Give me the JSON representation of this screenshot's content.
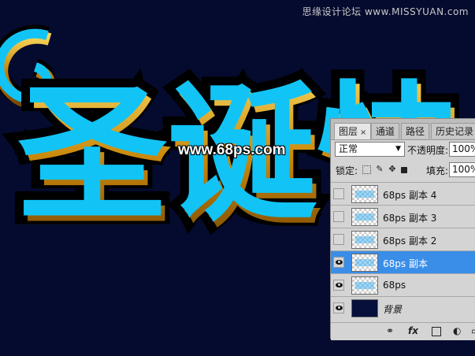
{
  "watermark": "思缘设计论坛 www.MISSYUAN.com",
  "artwork": {
    "headline": "圣诞快",
    "site": "www.68ps.com"
  },
  "layers_panel": {
    "tabs": [
      {
        "label": "图层",
        "close": "×"
      },
      {
        "label": "通道"
      },
      {
        "label": "路径"
      },
      {
        "label": "历史记录"
      }
    ],
    "blend_mode": "正常",
    "opacity_label": "不透明度:",
    "opacity_value": "100%",
    "lock_label": "锁定:",
    "fill_label": "填充:",
    "fill_value": "100%",
    "layers": [
      {
        "name": "68ps 副本 4",
        "visible": false,
        "selected": false
      },
      {
        "name": "68ps 副本 3",
        "visible": false,
        "selected": false
      },
      {
        "name": "68ps 副本 2",
        "visible": false,
        "selected": false
      },
      {
        "name": "68ps 副本",
        "visible": true,
        "selected": true
      },
      {
        "name": "68ps",
        "visible": true,
        "selected": false
      },
      {
        "name": "背景",
        "visible": true,
        "selected": false
      }
    ],
    "bottom_icons": [
      "link-icon",
      "fx-icon",
      "mask-icon",
      "adjustment-icon",
      "folder-icon"
    ],
    "fx_text": "fx"
  },
  "colors": {
    "canvas_bg": "#050b2e",
    "text_fill": "#11c4f5",
    "gold_edge": "#d89a12",
    "selection": "#3a8ee8"
  }
}
